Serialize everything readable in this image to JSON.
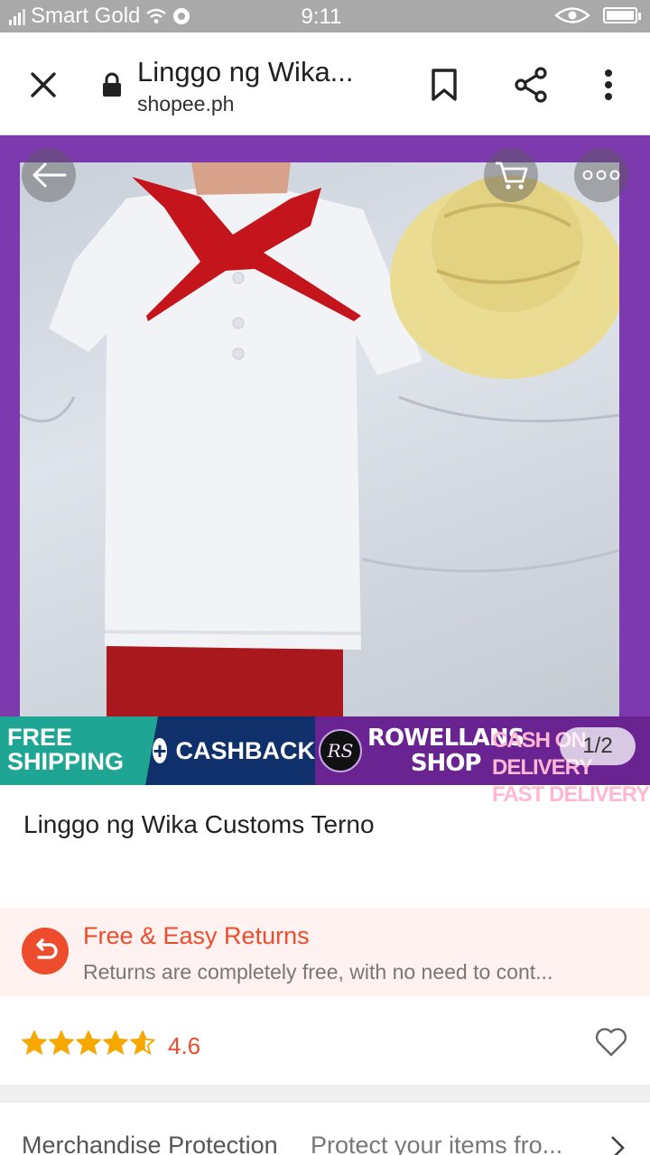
{
  "status_bar": {
    "carrier": "Smart Gold",
    "time": "9:11",
    "battery_level": 1.0
  },
  "browser": {
    "title": "Linggo ng Wika...",
    "domain": "shopee.ph",
    "icons": [
      "close-icon",
      "lock-icon",
      "bookmark-icon",
      "share-icon",
      "more-vert-icon"
    ]
  },
  "image": {
    "page_indicator": "1/2",
    "overlay_icons": [
      "back-arrow-icon",
      "cart-icon",
      "more-horiz-icon"
    ]
  },
  "promo": {
    "free_shipping": "FREE SHIPPING",
    "free_line1": "FREE",
    "free_line2": "SHIPPING",
    "cashback": "CASHBACK",
    "logo_text": "RS",
    "shop_line1": "ROWELLANS",
    "shop_line2": "SHOP",
    "tag_line1": "CASH ON DELIVERY",
    "tag_line2": "FAST DELIVERY"
  },
  "product": {
    "title": "Linggo ng Wika Customs Terno"
  },
  "returns": {
    "title": "Free & Easy Returns",
    "description": "Returns are completely free, with no need to cont..."
  },
  "rating": {
    "value": "4.6",
    "stars": 4.6
  },
  "protection": {
    "label": "Merchandise Protection",
    "description": "Protect your items fro..."
  },
  "colors": {
    "accent": "#ee4d2d",
    "image_border": "#7c3aae",
    "star": "#f6a700"
  }
}
